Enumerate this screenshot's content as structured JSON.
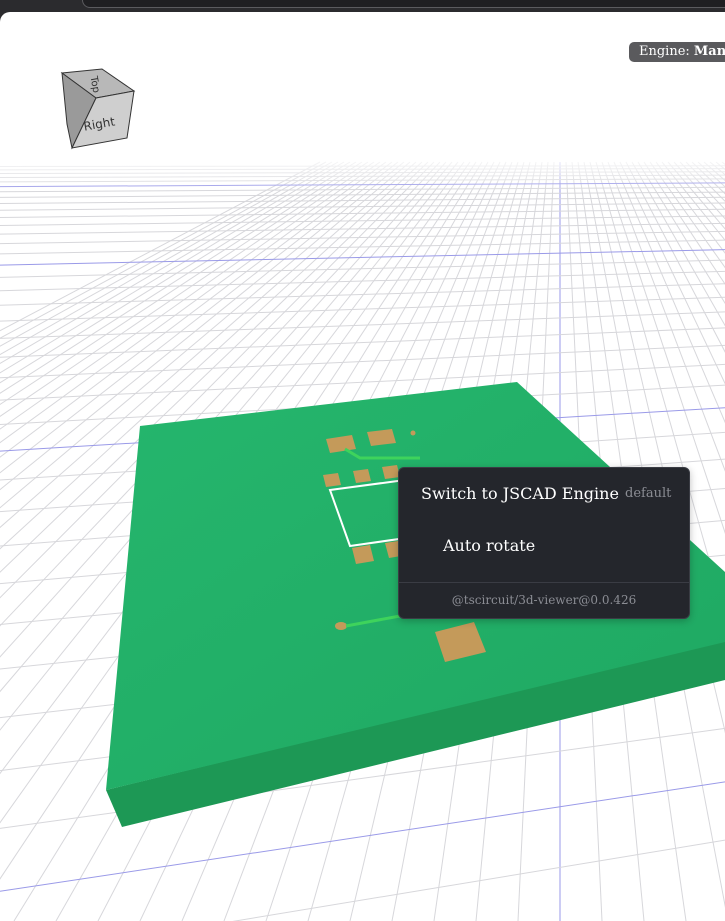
{
  "viewer": {
    "engine_prefix": "Engine: ",
    "engine_name": "Manifold",
    "cube_label_top": "Top",
    "cube_label_side": "Right",
    "colors": {
      "board": "#21ad67",
      "pad": "#c49a5a",
      "trace": "#3ed35c",
      "grid": "#d7d7db",
      "grid_axis": "#9a9ae8"
    }
  },
  "menu": {
    "switch_engine_label": "Switch to JSCAD Engine",
    "switch_engine_hint": "default",
    "auto_rotate_label": "Auto rotate",
    "version": "@tscircuit/3d-viewer@0.0.426"
  }
}
